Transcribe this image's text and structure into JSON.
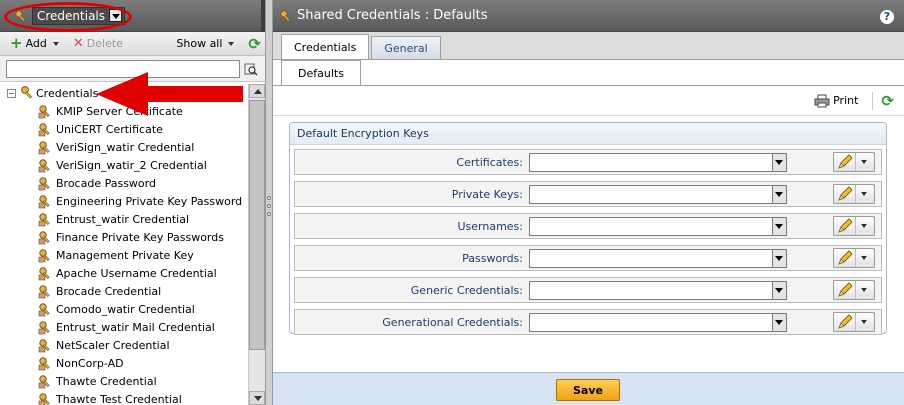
{
  "left_panel": {
    "selector_value": "Credentials",
    "toolbar": {
      "add_label": "Add",
      "delete_label": "Delete",
      "show_all_label": "Show all"
    },
    "search": {
      "value": "",
      "placeholder": ""
    },
    "tree": {
      "root_label": "Credentials",
      "items": [
        "KMIP Server Certificate",
        "UniCERT Certificate",
        "VeriSign_watir Credential",
        "VeriSign_watir_2 Credential",
        "Brocade Password",
        "Engineering Private Key Password",
        "Entrust_watir Credential",
        "Finance Private Key Passwords",
        "Management Private Key",
        "Apache Username Credential",
        "Brocade Credential",
        "Comodo_watir Credential",
        "Entrust_watir Mail Credential",
        "NetScaler Credential",
        "NonCorp-AD",
        "Thawte Credential",
        "Thawte Test Credential"
      ]
    }
  },
  "right_panel": {
    "title": "Shared Credentials : Defaults",
    "tabs": [
      {
        "label": "Credentials",
        "active": true
      },
      {
        "label": "General",
        "active": false
      }
    ],
    "subtabs": [
      {
        "label": "Defaults",
        "active": true
      }
    ],
    "print_label": "Print",
    "fieldset": {
      "legend": "Default Encryption Keys",
      "rows": [
        {
          "label": "Certificates:",
          "value": ""
        },
        {
          "label": "Private Keys:",
          "value": ""
        },
        {
          "label": "Usernames:",
          "value": ""
        },
        {
          "label": "Passwords:",
          "value": ""
        },
        {
          "label": "Generic Credentials:",
          "value": ""
        },
        {
          "label": "Generational Credentials:",
          "value": ""
        }
      ]
    },
    "save_label": "Save"
  },
  "colors": {
    "header_bg": "#6b6b6b",
    "annotation_red": "#e00000",
    "save_orange": "#f2a013",
    "label_blue": "#1c3c6c",
    "bottom_bar": "#d7e3f2"
  },
  "icons": {
    "credential_item": "key-icon",
    "add": "plus-icon",
    "delete": "x-icon",
    "refresh": "refresh-icon",
    "print": "printer-icon",
    "help": "help-icon",
    "edit": "pencil-icon"
  }
}
